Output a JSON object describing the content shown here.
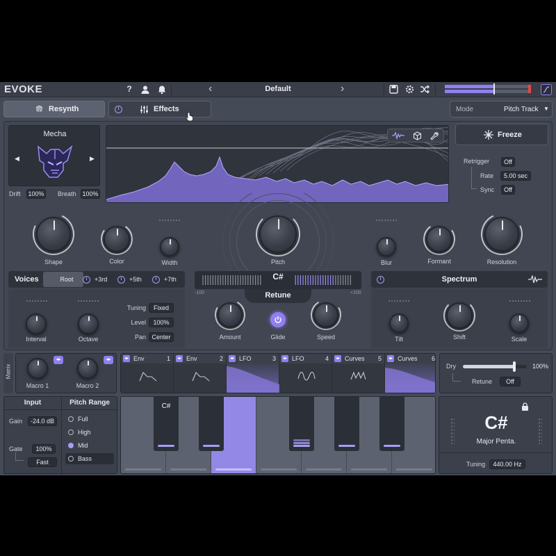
{
  "app": {
    "logo": "EVOKE"
  },
  "header": {
    "help_icon": "?",
    "preset_name": "Default",
    "prev_arrow": "‹",
    "next_arrow": "›",
    "resynth_label": "Resynth",
    "effects_label": "Effects",
    "mode_label": "Mode",
    "mode_value": "Pitch Track"
  },
  "source": {
    "name": "Mecha",
    "drift_label": "Drift",
    "drift_value": "100%",
    "breath_label": "Breath",
    "breath_value": "100%"
  },
  "freeze": {
    "label": "Freeze",
    "retrigger_label": "Retrigger",
    "retrigger_value": "Off",
    "rate_label": "Rate",
    "rate_value": "5.00 sec",
    "sync_label": "Sync",
    "sync_value": "Off"
  },
  "knobs": {
    "shape": "Shape",
    "color": "Color",
    "width": "Width",
    "pitch": "Pitch",
    "blur": "Blur",
    "formant": "Formant",
    "resolution": "Resolution"
  },
  "voices": {
    "title": "Voices",
    "root": "Root",
    "third": "+3rd",
    "fifth": "+5th",
    "seventh": "+7th",
    "interval": "Interval",
    "octave": "Octave",
    "tuning_label": "Tuning",
    "tuning_value": "Fixed",
    "level_label": "Level",
    "level_value": "100%",
    "pan_label": "Pan",
    "pan_value": "Center"
  },
  "retune": {
    "note": "C#",
    "label": "Retune",
    "min": "-100",
    "max": "+100",
    "amount": "Amount",
    "glide": "Glide",
    "speed": "Speed"
  },
  "spectrum": {
    "title": "Spectrum",
    "tilt": "Tilt",
    "shift": "Shift",
    "scale": "Scale"
  },
  "matrix": {
    "label": "Matrix",
    "macro1": "Macro 1",
    "macro2": "Macro 2",
    "slots": [
      {
        "name": "Env",
        "num": "1"
      },
      {
        "name": "Env",
        "num": "2"
      },
      {
        "name": "LFO",
        "num": "3"
      },
      {
        "name": "LFO",
        "num": "4"
      },
      {
        "name": "Curves",
        "num": "5"
      },
      {
        "name": "Curves",
        "num": "6"
      }
    ]
  },
  "output": {
    "dry_label": "Dry",
    "dry_value": "100%",
    "dry_level": 0.8,
    "retune_label": "Retune",
    "retune_value": "Off"
  },
  "input": {
    "title": "Input",
    "gain_label": "Gain",
    "gain_value": "-24.0 dB",
    "gate_label": "Gate",
    "gate_value": "100%",
    "speed_value": "Fast"
  },
  "pitch_range": {
    "title": "Pitch Range",
    "options": [
      "Full",
      "High",
      "Mid",
      "Bass"
    ],
    "selected": "Mid"
  },
  "keyboard": {
    "active_note": "C#"
  },
  "scale": {
    "key": "C#",
    "name": "Major Penta.",
    "tuning_label": "Tuning",
    "tuning_value": "440.00 Hz"
  },
  "colors": {
    "accent": "#9b8cf0",
    "background": "#454a57",
    "panel": "#3e434f"
  }
}
